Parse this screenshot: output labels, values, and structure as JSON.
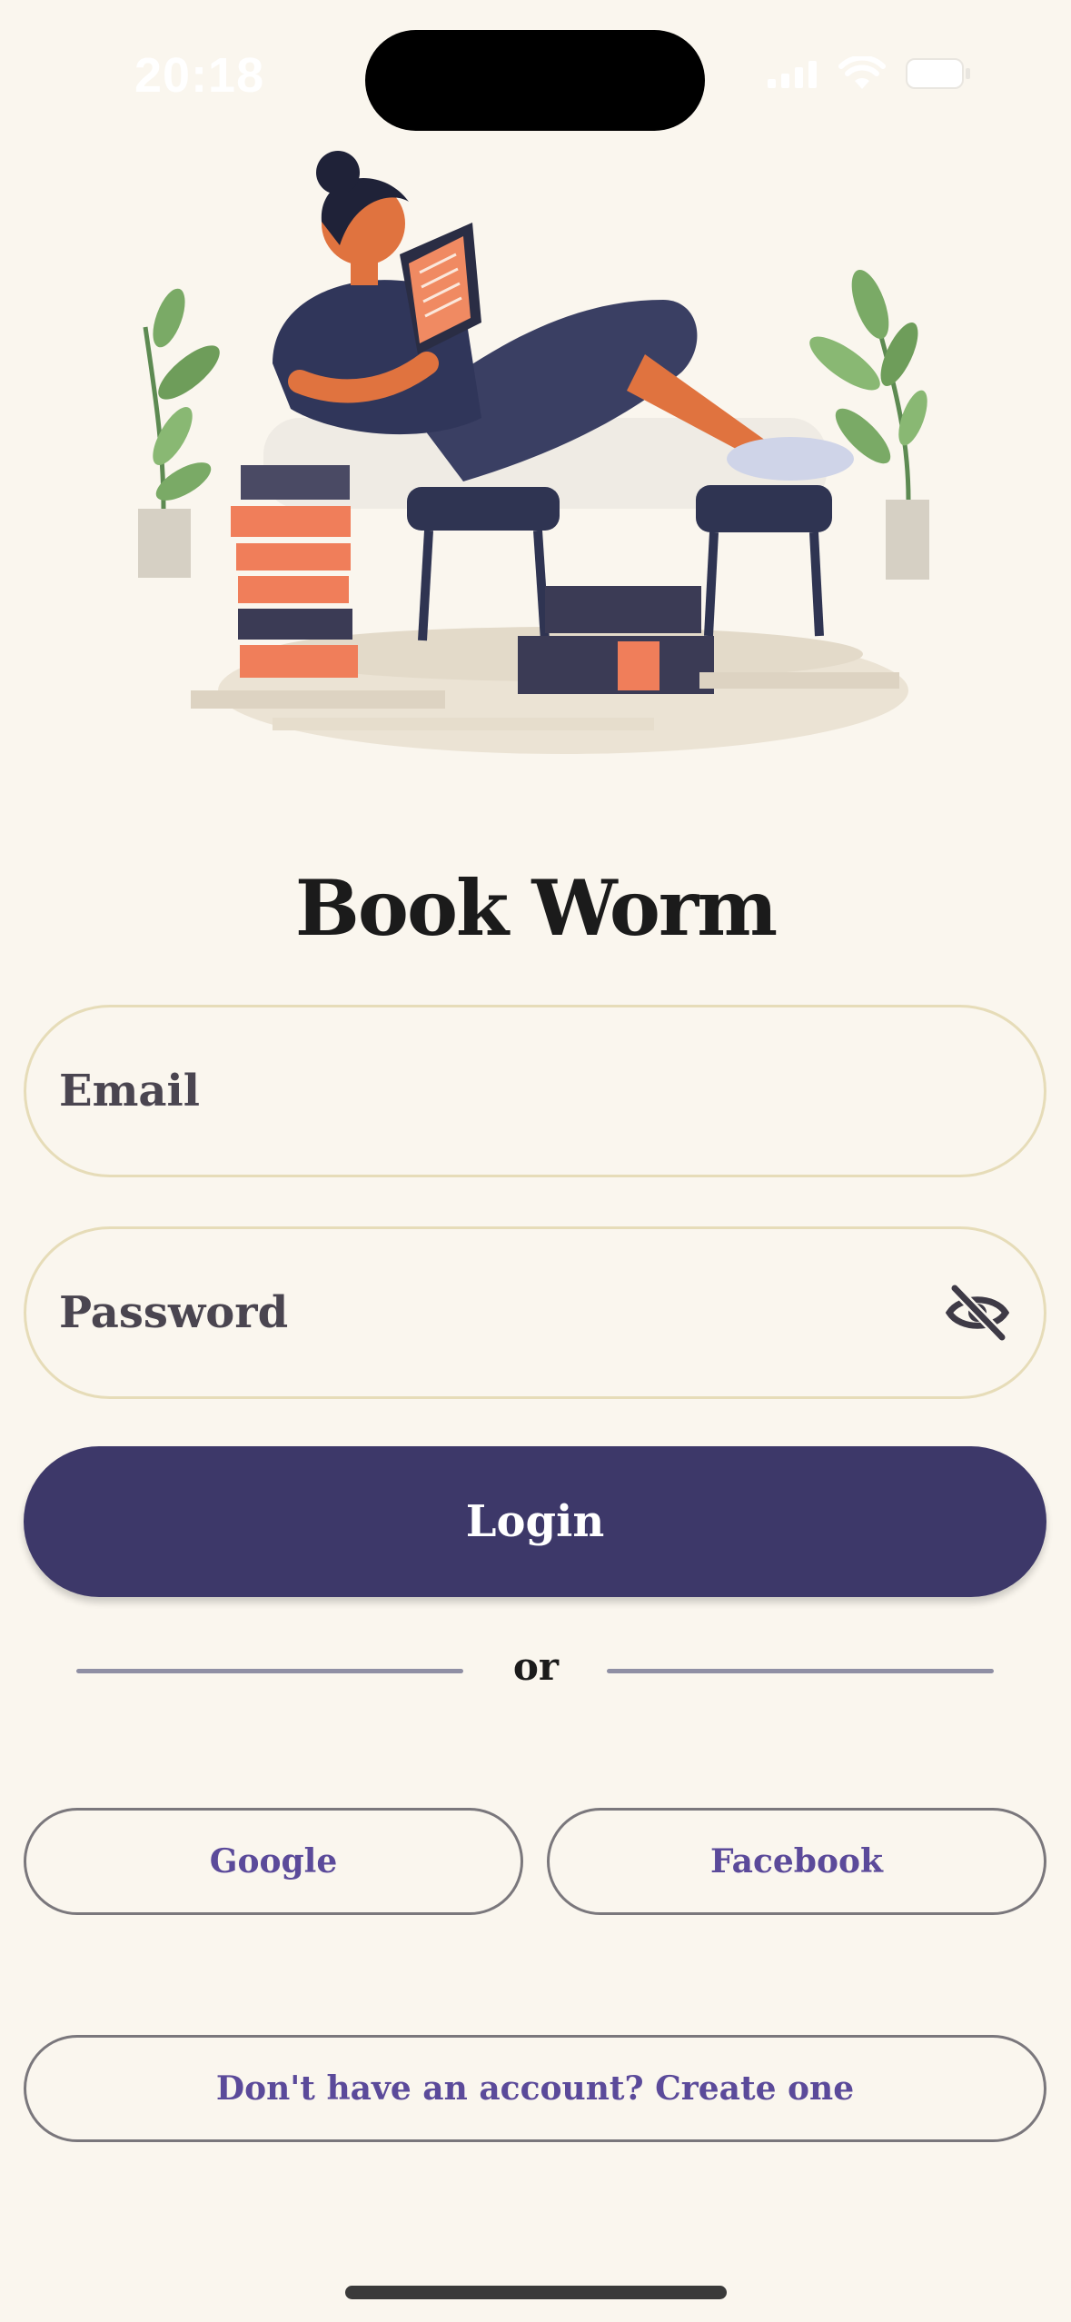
{
  "status_bar": {
    "time": "20:18",
    "icons": [
      "signal-icon",
      "wifi-icon",
      "battery-icon"
    ]
  },
  "hero": {
    "image": "reading-illustration"
  },
  "app": {
    "title": "Book Worm"
  },
  "form": {
    "email_placeholder": "Email",
    "password_placeholder": "Password",
    "password_toggle_icon": "eye-slash-icon",
    "login_label": "Login",
    "divider_text": "or"
  },
  "social": {
    "google_label": "Google",
    "facebook_label": "Facebook"
  },
  "signup": {
    "label": "Don't have an account? Create one"
  },
  "colors": {
    "background": "#faf6ee",
    "primary": "#3d3869",
    "link_text": "#5b4a9a",
    "field_border": "#e6dcb8"
  }
}
